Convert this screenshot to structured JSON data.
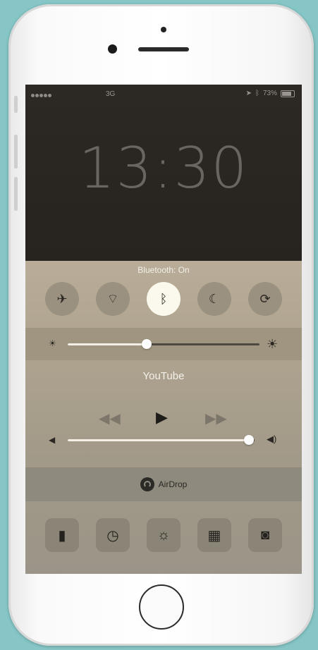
{
  "status_bar": {
    "carrier": "3G",
    "battery": "73%"
  },
  "lock_screen": {
    "time": "13:30"
  },
  "control_center": {
    "bluetooth_status": "Bluetooth: On",
    "toggles": [
      {
        "name": "airplane-mode",
        "icon": "airplane-icon",
        "glyph": "✈",
        "on": false
      },
      {
        "name": "wifi",
        "icon": "wifi-icon",
        "glyph": "⌔",
        "on": false
      },
      {
        "name": "bluetooth",
        "icon": "bluetooth-icon",
        "glyph": "ᛒ",
        "on": true
      },
      {
        "name": "do-not-disturb",
        "icon": "moon-icon",
        "glyph": "☾",
        "on": false
      },
      {
        "name": "rotation-lock",
        "icon": "rotation-lock-icon",
        "glyph": "⟳",
        "on": false
      }
    ],
    "brightness_level": 0.41,
    "now_playing": {
      "title": "YouTube"
    },
    "volume_level": 0.97,
    "airdrop_label": "AirDrop",
    "shortcuts": [
      {
        "name": "flashlight",
        "icon": "flashlight-icon",
        "glyph": "▮"
      },
      {
        "name": "timer",
        "icon": "timer-icon",
        "glyph": "◷"
      },
      {
        "name": "calculator-light",
        "icon": "brightness-icon",
        "glyph": "☼"
      },
      {
        "name": "calculator",
        "icon": "calculator-icon",
        "glyph": "▦"
      },
      {
        "name": "camera",
        "icon": "camera-icon",
        "glyph": "◙"
      }
    ]
  },
  "colors": {
    "background": "#86c6c6",
    "toggle_on": "#fbf8ee"
  }
}
